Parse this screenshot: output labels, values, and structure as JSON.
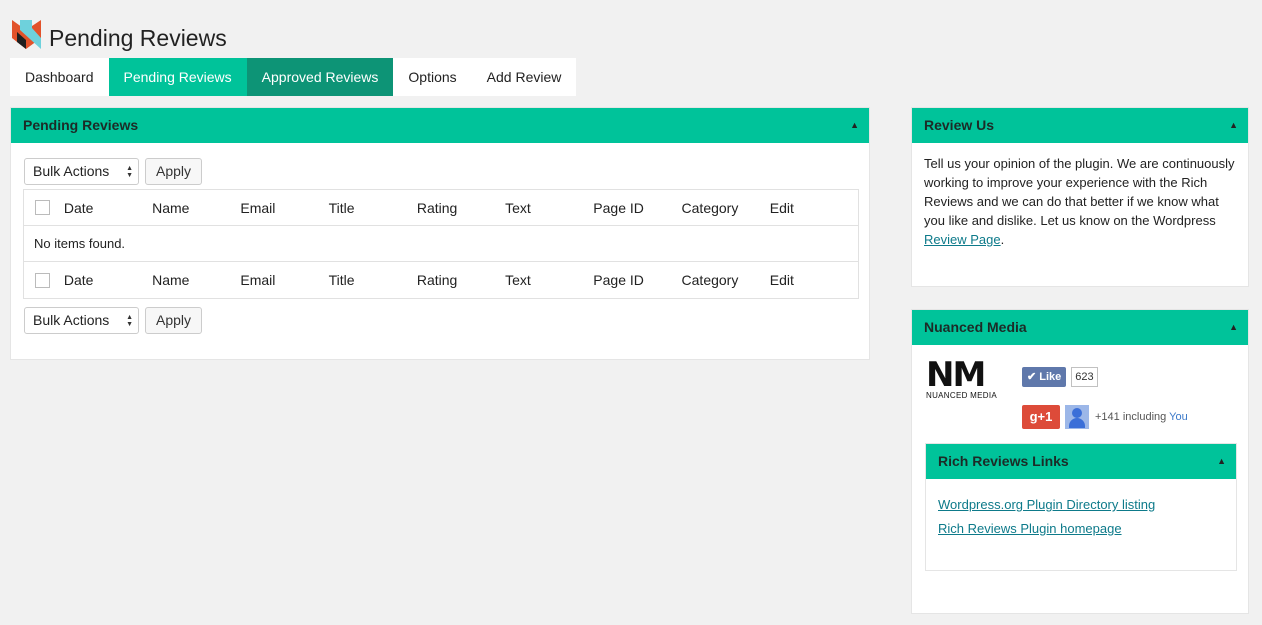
{
  "header": {
    "title": "Pending Reviews",
    "logo_icon": "fox-logo-icon"
  },
  "tabs": [
    {
      "label": "Dashboard",
      "state": "default"
    },
    {
      "label": "Pending Reviews",
      "state": "active"
    },
    {
      "label": "Approved Reviews",
      "state": "hover"
    },
    {
      "label": "Options",
      "state": "default"
    },
    {
      "label": "Add Review",
      "state": "default"
    }
  ],
  "main": {
    "panel_title": "Pending Reviews",
    "bulk_actions_top": {
      "value": "Bulk Actions",
      "apply_label": "Apply"
    },
    "bulk_actions_bottom": {
      "value": "Bulk Actions",
      "apply_label": "Apply"
    },
    "columns": [
      "Date",
      "Name",
      "Email",
      "Title",
      "Rating",
      "Text",
      "Page ID",
      "Category",
      "Edit"
    ],
    "empty_message": "No items found."
  },
  "review_us": {
    "title": "Review Us",
    "text": "Tell us your opinion of the plugin. We are continuously working to improve your experience with the Rich Reviews and we can do that better if we know what you like and dislike. Let us know on the Wordpress ",
    "link_label": "Review Page",
    "text_end": "."
  },
  "nuanced": {
    "title": "Nuanced Media",
    "logo_letters": "NM",
    "logo_caption": "NUANCED MEDIA",
    "fb_like_label": "Like",
    "fb_count": "623",
    "gplus_label": "g+1",
    "gplus_count": "+141 including",
    "gplus_you": "You",
    "links_panel": {
      "title": "Rich Reviews Links",
      "links": [
        "Wordpress.org Plugin Directory listing",
        "Rich Reviews Plugin homepage"
      ]
    }
  },
  "colors": {
    "accent": "#00c39a",
    "accent_dark": "#0d9476",
    "link": "#0d7a8a"
  }
}
